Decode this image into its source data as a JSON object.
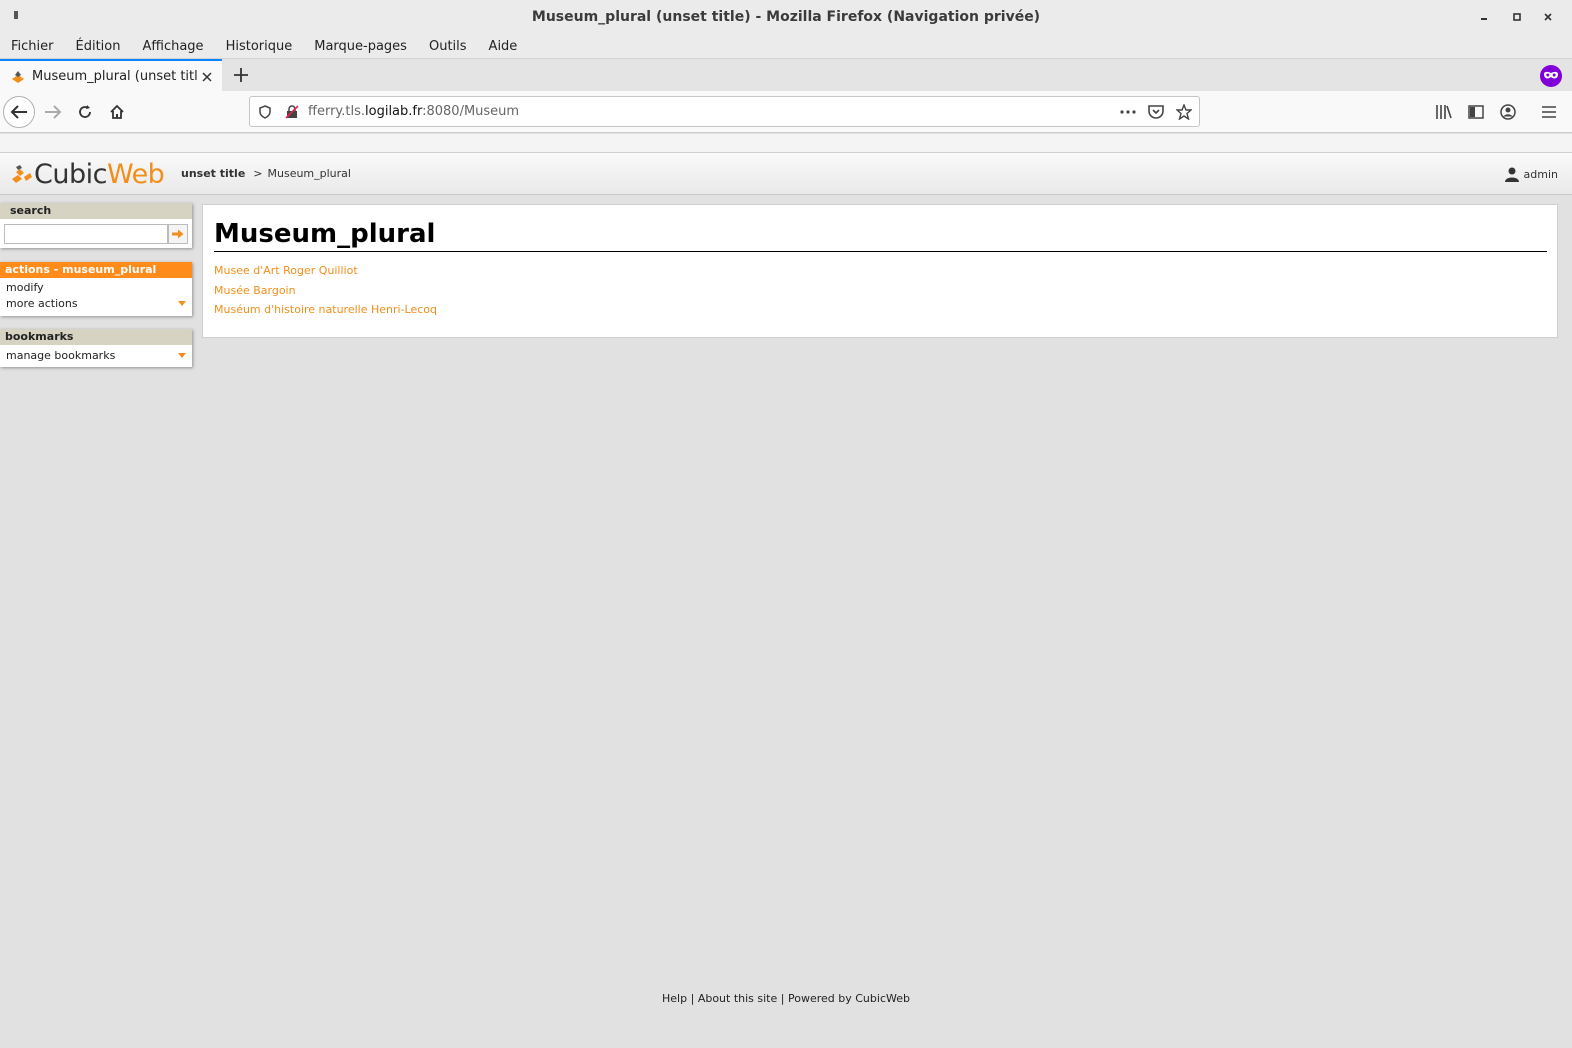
{
  "window": {
    "title": "Museum_plural (unset title) - Mozilla Firefox (Navigation privée)"
  },
  "menu": [
    "Fichier",
    "Édition",
    "Affichage",
    "Historique",
    "Marque-pages",
    "Outils",
    "Aide"
  ],
  "tab": {
    "title": "Museum_plural (unset title)"
  },
  "urlbar": {
    "prefix": "fferry.tls.",
    "domain": "logilab.fr",
    "suffix": ":8080/Museum"
  },
  "header": {
    "logo_part1": "Cubic",
    "logo_part2": "Web",
    "breadcrumb_root": "unset title",
    "breadcrumb_sep": ">",
    "breadcrumb_current": "Museum_plural",
    "user": "admin"
  },
  "sidebar": {
    "search_title": "search",
    "actions_title": "actions - museum_plural",
    "actions": [
      "modify",
      "more actions"
    ],
    "bookmarks_title": "bookmarks",
    "bookmarks": [
      "manage bookmarks"
    ]
  },
  "main": {
    "title": "Museum_plural",
    "items": [
      "Musee d'Art Roger Quilliot",
      "Musée Bargoin",
      "Muséum d'histoire naturelle Henri-Lecoq"
    ]
  },
  "footer": {
    "help": "Help",
    "about": "About this site",
    "powered": "Powered by CubicWeb",
    "sep": "|"
  },
  "colors": {
    "accent": "#f28e1b",
    "private": "#8000d7",
    "tab_highlight": "#0a84ff"
  }
}
